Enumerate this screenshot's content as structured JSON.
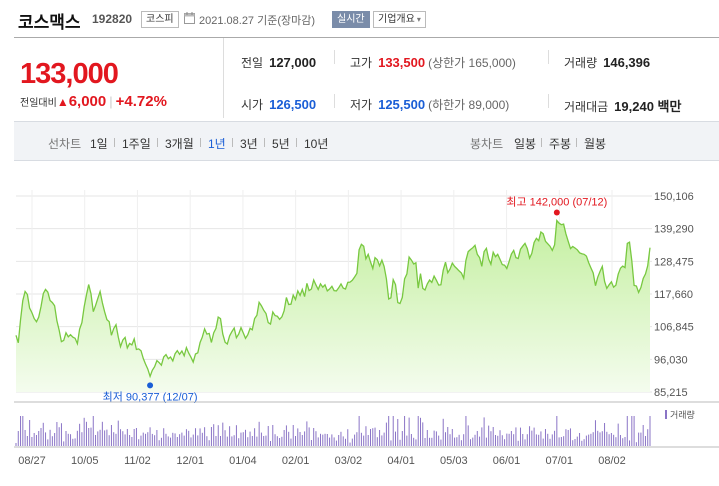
{
  "header": {
    "stock_name": "코스맥스",
    "stock_code": "192820",
    "market": "코스피",
    "date_text": "2021.08.27  기준(장마감)",
    "realtime_label": "실시간",
    "company_info_label": "기업개요",
    "icons": [
      "calendar-icon",
      "chevron-down-icon"
    ]
  },
  "price": {
    "current": "133,000",
    "change_label": "전일대비",
    "change_amount": "6,000",
    "change_rate": "+4.72%",
    "color_up": "#e2171f",
    "color_down": "#1a5ed6"
  },
  "stats": {
    "prev_close": {
      "label": "전일",
      "value": "127,000"
    },
    "high": {
      "label": "고가",
      "value": "133,500",
      "sub": "(상한가 165,000)"
    },
    "volume": {
      "label": "거래량",
      "value": "146,396"
    },
    "open": {
      "label": "시가",
      "value": "126,500"
    },
    "low": {
      "label": "저가",
      "value": "125,500",
      "sub": "(하한가 89,000)"
    },
    "amount": {
      "label": "거래대금",
      "value": "19,240 백만"
    }
  },
  "periods": {
    "line_label": "선차트",
    "items": [
      "1일",
      "1주일",
      "3개월",
      "1년",
      "3년",
      "5년",
      "10년"
    ],
    "selected": "1년",
    "candle_label": "봉차트",
    "candle_items": [
      "일봉",
      "주봉",
      "월봉"
    ]
  },
  "chart_data": {
    "type": "area",
    "y_ticks": [
      "150,106",
      "139,290",
      "128,475",
      "117,660",
      "106,845",
      "96,030",
      "85,215"
    ],
    "ylim": [
      85215,
      150106
    ],
    "x_ticks": [
      "08/27",
      "10/05",
      "11/02",
      "12/01",
      "01/04",
      "02/01",
      "03/02",
      "04/01",
      "05/03",
      "06/01",
      "07/01",
      "08/02"
    ],
    "series": [
      {
        "values": [
          104000,
          101500,
          109000,
          115500,
          118500,
          117500,
          113000,
          111500,
          109500,
          108500,
          110000,
          113500,
          117800,
          119200,
          118300,
          115500,
          114800,
          113800,
          108800,
          105600,
          101900,
          102300,
          104800,
          103500,
          104200,
          103400,
          103000,
          101200,
          106000,
          108200,
          113500,
          117300,
          120800,
          117700,
          111800,
          113800,
          116200,
          118500,
          114700,
          111800,
          109200,
          108500,
          104000,
          106200,
          107500,
          103400,
          100200,
          102400,
          103300,
          99800,
          101300,
          100800,
          102800,
          99300,
          99500,
          98900,
          96300,
          94500,
          92800,
          90377,
          92400,
          93600,
          95600,
          94900,
          94100,
          96800,
          97600,
          96200,
          96800,
          95500,
          97900,
          98900,
          97700,
          98800,
          97200,
          99900,
          98100,
          96700,
          95100,
          97800,
          98200,
          101600,
          103400,
          106100,
          104400,
          104600,
          101600,
          104800,
          106300,
          110000,
          109500,
          104400,
          101700,
          101100,
          103800,
          105200,
          106400,
          103200,
          104400,
          106500,
          104800,
          103000,
          104200,
          106300,
          105800,
          109500,
          110600,
          114900,
          113800,
          112300,
          111200,
          108200,
          107700,
          111700,
          110500,
          110300,
          109300,
          110100,
          112100,
          116500,
          114200,
          114300,
          117300,
          115800,
          118700,
          117200,
          119200,
          116800,
          121200,
          118800,
          119300,
          122300,
          120600,
          119200,
          121000,
          119900,
          120700,
          118700,
          119300,
          120200,
          118800,
          118700,
          119700,
          121000,
          119600,
          119300,
          121500,
          121600,
          122200,
          123300,
          124500,
          132300,
          134100,
          133500,
          129300,
          130800,
          128300,
          126100,
          129700,
          129000,
          127000,
          128900,
          126800,
          122700,
          116000,
          116400,
          122400,
          120800,
          114800,
          114500,
          116500,
          122700,
          124300,
          129900,
          128900,
          127600,
          128000,
          119600,
          124400,
          119500,
          119000,
          121000,
          122300,
          121500,
          123600,
          122200,
          120600,
          120700,
          125500,
          128200,
          124700,
          125900,
          127900,
          126800,
          126100,
          125300,
          124600,
          122900,
          128800,
          131700,
          132400,
          133000,
          133800,
          130800,
          129700,
          126800,
          131700,
          132800,
          129200,
          127500,
          131500,
          130000,
          130800,
          129100,
          127400,
          127200,
          126100,
          128400,
          130900,
          132100,
          129700,
          129400,
          132500,
          133500,
          134400,
          132700,
          129500,
          131100,
          134700,
          136100,
          135300,
          138200,
          137600,
          135100,
          134300,
          133500,
          132100,
          133900,
          142000,
          141100,
          140600,
          140800,
          137600,
          135100,
          132700,
          133400,
          132900,
          132300,
          131300,
          131000,
          130800,
          130200,
          128100,
          126300,
          124600,
          120400,
          123200,
          125100,
          126800,
          121800,
          119500,
          120700,
          121700,
          119900,
          120600,
          124200,
          126200,
          126900,
          126400,
          134400,
          134800,
          128700,
          120500,
          120300,
          118200,
          119800,
          122800,
          124300,
          127000,
          133000
        ]
      }
    ],
    "volume_label": "거래량",
    "annotations": {
      "high": {
        "text": "최고 142,000 (07/12)",
        "color": "#e2171f"
      },
      "low": {
        "text": "최저 90,377 (12/07)",
        "color": "#1a5ed6"
      }
    },
    "colors": {
      "line": "#78c840",
      "fill_top": "#c4efa0",
      "fill_bottom": "#f4fcee",
      "volume": "#8a74c6",
      "grid": "#e6e6e6"
    }
  }
}
